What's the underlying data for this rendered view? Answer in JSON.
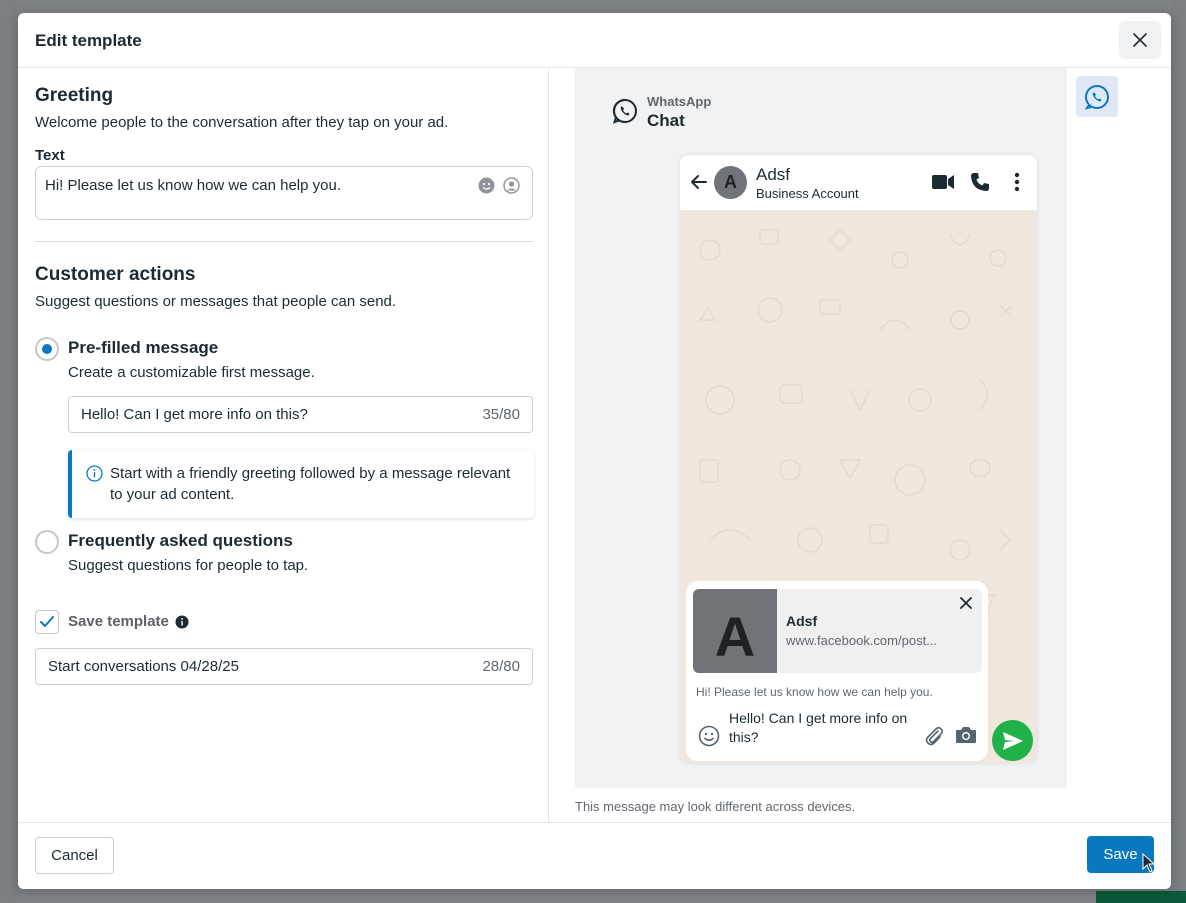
{
  "modal": {
    "title": "Edit template"
  },
  "greeting": {
    "title": "Greeting",
    "subtitle": "Welcome people to the conversation after they tap on your ad.",
    "text_label": "Text",
    "text_value": "Hi! Please let us know how we can help you."
  },
  "customer_actions": {
    "title": "Customer actions",
    "subtitle": "Suggest questions or messages that people can send.",
    "prefilled": {
      "title": "Pre-filled message",
      "subtitle": "Create a customizable first message.",
      "selected": true,
      "input_value": "Hello! Can I get more info on this?",
      "counter": "35/80",
      "info_text": "Start with a friendly greeting followed by a message relevant to your ad content."
    },
    "faq": {
      "title": "Frequently asked questions",
      "subtitle": "Suggest questions for people to tap.",
      "selected": false
    }
  },
  "save_template": {
    "label": "Save template",
    "checked": true,
    "input_value": "Start conversations 04/28/25",
    "counter": "28/80"
  },
  "preview": {
    "platform_label": "WhatsApp",
    "view_label": "Chat",
    "contact_initial": "A",
    "contact_name": "Adsf",
    "contact_sub": "Business Account",
    "link_title": "Adsf",
    "link_url": "www.facebook.com/post...",
    "greeting": "Hi! Please let us know how we can help you.",
    "message": "Hello! Can I get more info on this?",
    "disclaimer": "This message may look different across devices."
  },
  "footer": {
    "cancel_label": "Cancel",
    "save_label": "Save"
  },
  "colors": {
    "accent": "#0a78be",
    "send": "#21b14a"
  }
}
